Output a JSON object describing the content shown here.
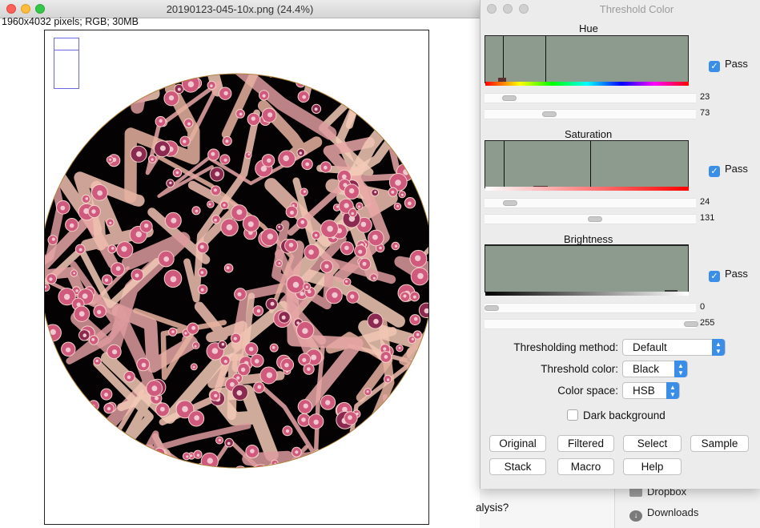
{
  "image_window": {
    "title": "20190123-045-10x.png (24.4%)",
    "info": "1960x4032 pixels; RGB; 30MB"
  },
  "threshold_window": {
    "title": "Threshold Color",
    "hue": {
      "label": "Hue",
      "pass_label": "Pass",
      "pass_checked": true,
      "min": "23",
      "max": "73",
      "min_fraction": 0.09,
      "max_fraction": 0.29
    },
    "saturation": {
      "label": "Saturation",
      "pass_label": "Pass",
      "pass_checked": true,
      "min": "24",
      "max": "131",
      "min_fraction": 0.09,
      "max_fraction": 0.51
    },
    "brightness": {
      "label": "Brightness",
      "pass_label": "Pass",
      "pass_checked": true,
      "min": "0",
      "max": "255",
      "min_fraction": 0.0,
      "max_fraction": 1.0
    },
    "thresholding_method": {
      "label": "Thresholding method:",
      "value": "Default"
    },
    "threshold_color": {
      "label": "Threshold color:",
      "value": "Black"
    },
    "color_space": {
      "label": "Color space:",
      "value": "HSB"
    },
    "dark_background": {
      "label": "Dark background",
      "checked": false
    },
    "buttons": {
      "original": "Original",
      "filtered": "Filtered",
      "select": "Select",
      "sample": "Sample",
      "stack": "Stack",
      "macro": "Macro",
      "help": "Help"
    }
  },
  "background": {
    "partial_text": "alysis?",
    "sidebar_items": [
      "Dropbox",
      "Downloads"
    ]
  },
  "colors": {
    "histogram_fill": "#8c9b8e",
    "accent": "#3b8ee8",
    "tissue_pink": "#e8a0b0",
    "nucleus": "#c0406a"
  }
}
